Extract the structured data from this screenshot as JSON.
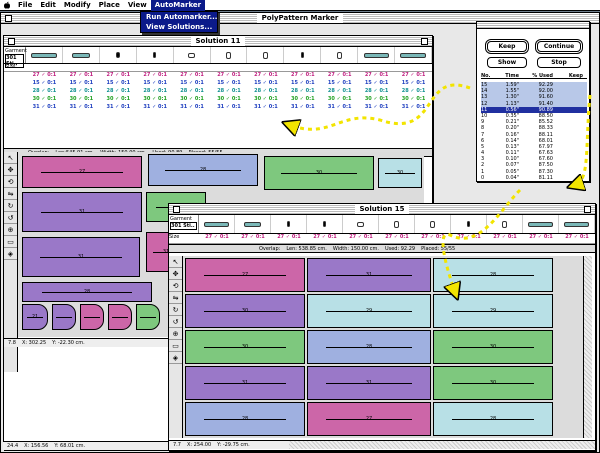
{
  "menubar": {
    "items": [
      "File",
      "Edit",
      "Modify",
      "Place",
      "View",
      "AutoMarker"
    ],
    "active": "AutoMarker"
  },
  "dropdown": {
    "items": [
      "Run Automarker...",
      "View Solutions..."
    ]
  },
  "bg_window": {
    "title": "PolyPattern Marker"
  },
  "win11": {
    "title": "Solution 11",
    "garment_label": "Garment",
    "garment_value": "301 Sti..",
    "size_label": "Size:",
    "rows": [
      "27 ✓ 0:1",
      "15 ✓ 0:1",
      "28 ✓ 0:1",
      "30 ✓ 0:1",
      "31 ✓ 0:1"
    ],
    "status": {
      "overlap": "Overlap:",
      "len": "Len:545.91 cm.",
      "width": "Width: 150.00 cm.",
      "used": "Used: 90.89",
      "placed": "Placed: 55/55"
    },
    "bottom": {
      "zoom": "7.8",
      "x": "X: 302.25",
      "y": "Y: -22.30 cm."
    }
  },
  "outer_bottom": {
    "zoom": "24.4",
    "x": "X: 156.56",
    "y": "Y: 68.01 cm."
  },
  "win15": {
    "title": "Solution 15",
    "garment_label": "Garment",
    "garment_value": "301 Sti..",
    "size_label": "Size",
    "rowval": "27 ✓ 0:1",
    "status": {
      "overlap": "Overlap:",
      "len": "Len: 538.85 cm.",
      "width": "Width: 150.00 cm.",
      "used": "Used: 92.29",
      "placed": "Placed: 55/55"
    },
    "bottom": {
      "zoom": "7.7",
      "x": "X: 254.00",
      "y": "Y: -29.75 cm."
    }
  },
  "panel": {
    "buttons": {
      "keep": "Keep",
      "continue": "Continue",
      "show": "Show",
      "stop": "Stop"
    },
    "columns": [
      "No.",
      "Time",
      "% Used",
      "Keep"
    ],
    "rows": [
      [
        "15",
        "1.59\"",
        "92.29"
      ],
      [
        "14",
        "1.55\"",
        "92.00"
      ],
      [
        "13",
        "1.30\"",
        "91.60"
      ],
      [
        "12",
        "1.13\"",
        "91.40"
      ],
      [
        "11",
        "0.56\"",
        "90.89"
      ],
      [
        "10",
        "0.35\"",
        "88.50"
      ],
      [
        "9",
        "0.21\"",
        "85.52"
      ],
      [
        "8",
        "0.20\"",
        "88.33"
      ],
      [
        "7",
        "0.16\"",
        "88.11"
      ],
      [
        "6",
        "0.14\"",
        "68.01"
      ],
      [
        "5",
        "0.13\"",
        "67.97"
      ],
      [
        "4",
        "0.11\"",
        "67.63"
      ],
      [
        "3",
        "0.10\"",
        "67.60"
      ],
      [
        "2",
        "0.07\"",
        "87.50"
      ],
      [
        "1",
        "0.05\"",
        "87.30"
      ],
      [
        "0",
        "0.04\"",
        "81.11"
      ]
    ]
  },
  "pieces11": [
    "27",
    "28",
    "30",
    "31",
    "31",
    "29",
    "30",
    "31",
    "28",
    "21"
  ],
  "pieces15": [
    "27",
    "31",
    "28",
    "30",
    "29",
    "29",
    "30",
    "28",
    "30",
    "31",
    "31",
    "30",
    "28",
    "27",
    "28"
  ]
}
